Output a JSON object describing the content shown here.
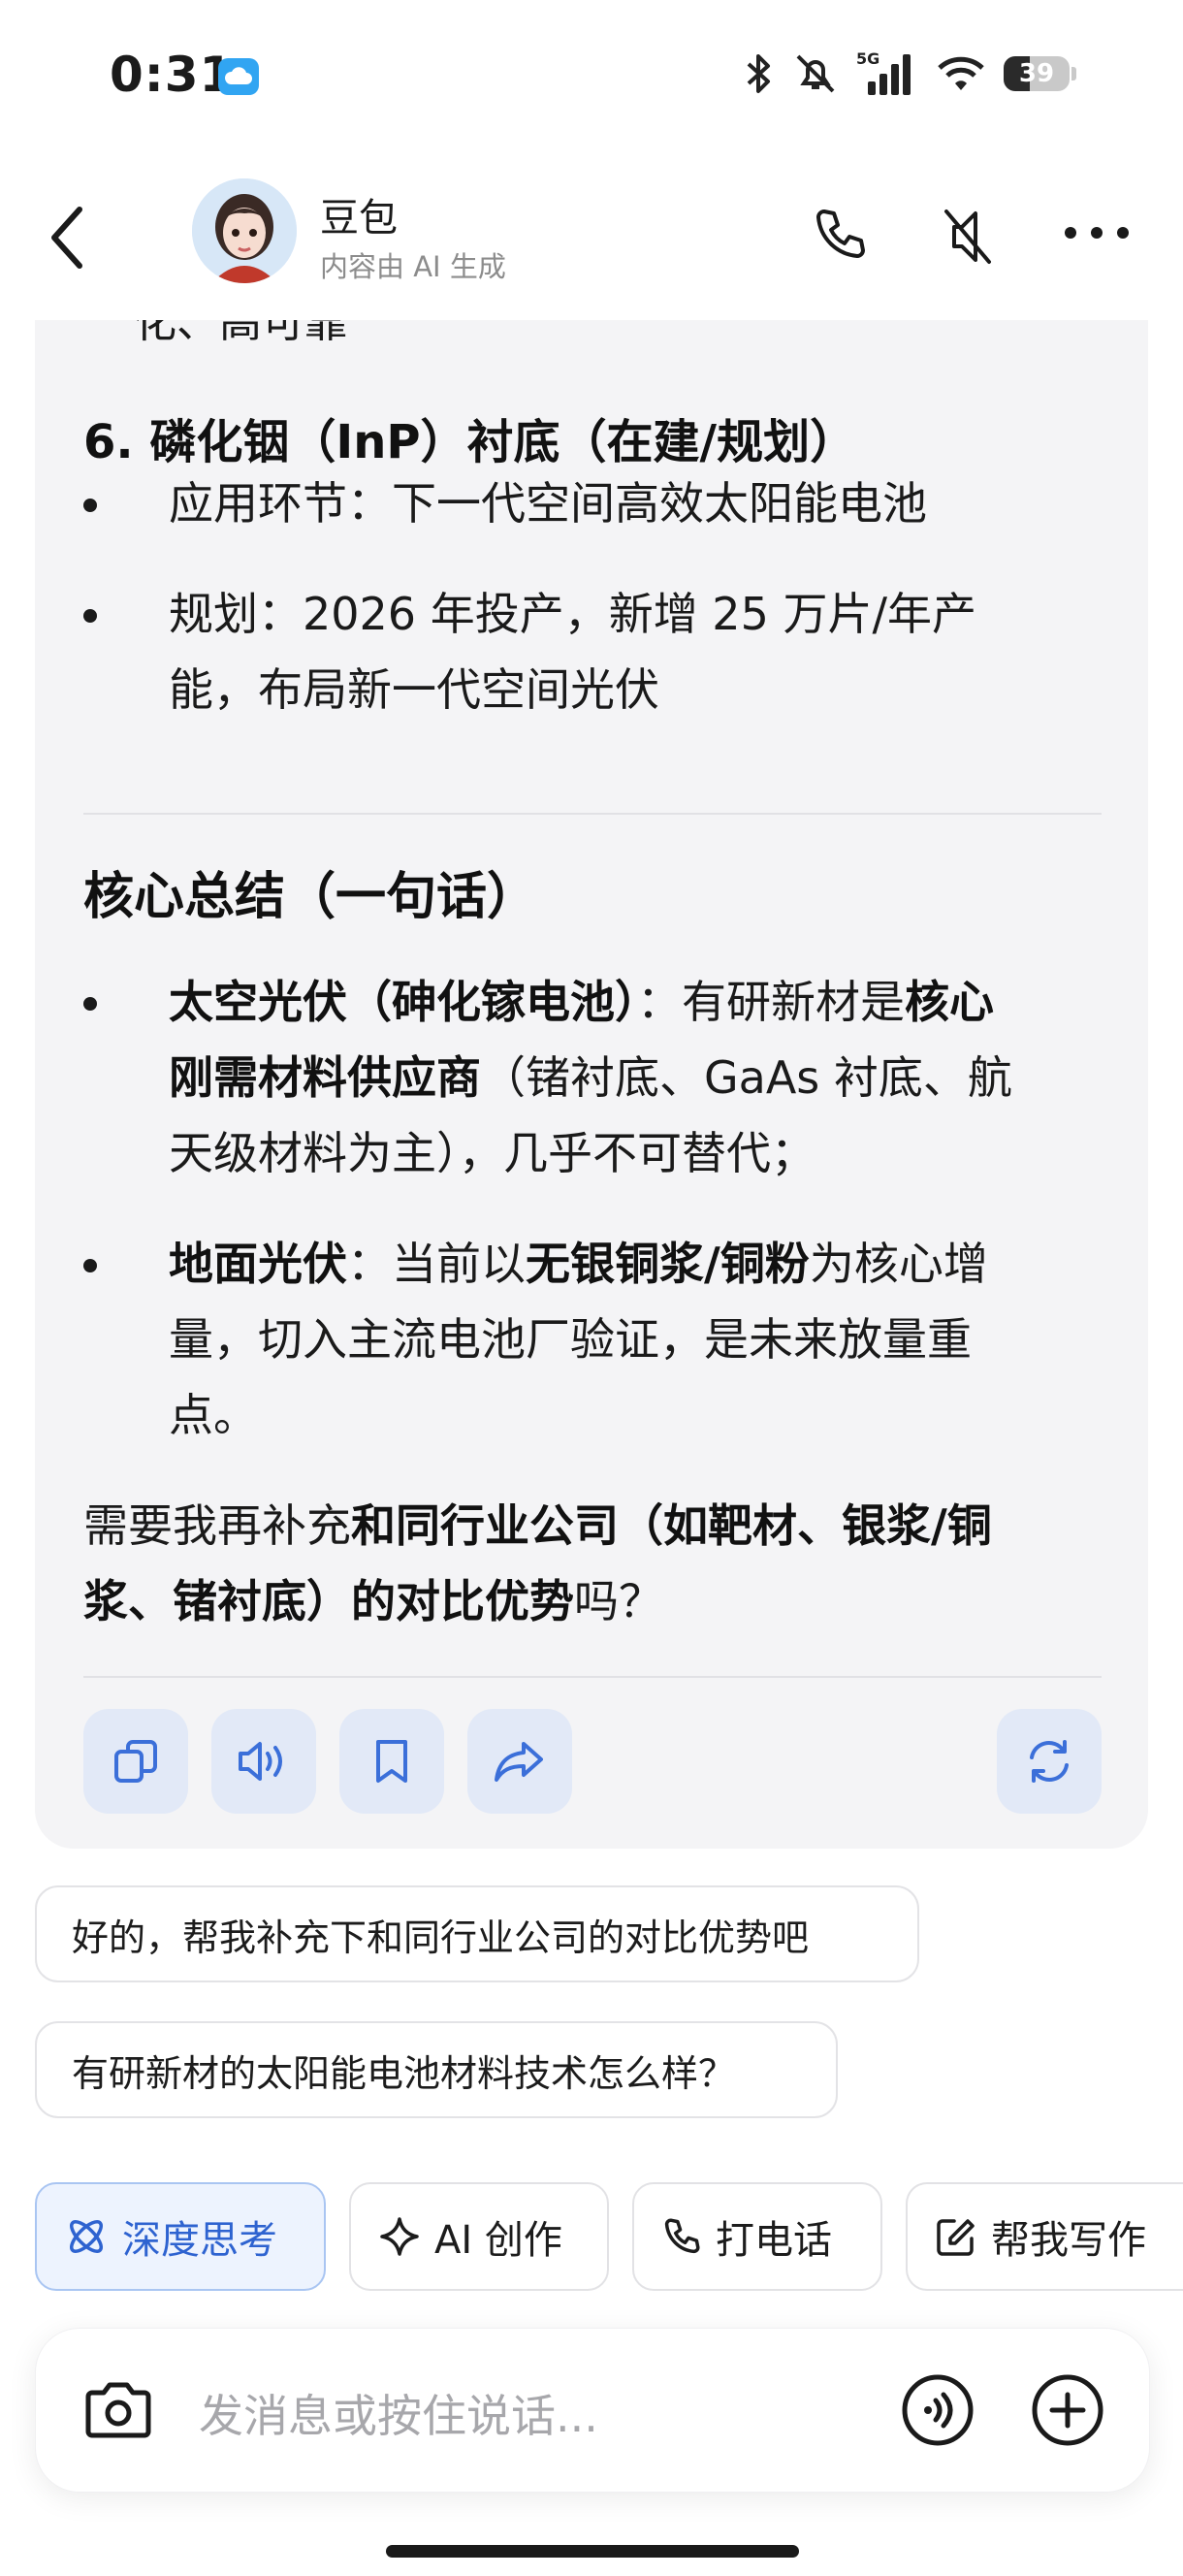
{
  "status_bar": {
    "time": "0:31",
    "battery": "39",
    "network": "5G"
  },
  "header": {
    "name": "豆包",
    "subtitle": "内容由 AI 生成"
  },
  "message": {
    "cut_line": "化、高可靠",
    "section6_title": "6. 磷化铟（InP）衬底（在建/规划）",
    "s6_b1": "应用环节：下一代空间高效太阳能电池",
    "s6_b2_l1": "规划：2026 年投产，新增 25 万片/年产",
    "s6_b2_l2": "能，布局新一代空间光伏",
    "summary_title": "核心总结（一句话）",
    "sum1_l1_bold": "太空光伏（砷化镓电池）",
    "sum1_l1_mid": "：有研新材是",
    "sum1_l1_bold2": "核心",
    "sum1_l2_bold": "刚需材料供应商",
    "sum1_l2_rest": "（锗衬底、GaAs 衬底、航",
    "sum1_l3": "天级材料为主），几乎不可替代；",
    "sum2_l1_bold": "地面光伏",
    "sum2_l1_mid": "：当前以",
    "sum2_l1_bold2": "无银铜浆/铜粉",
    "sum2_l1_rest": "为核心增",
    "sum2_l2": "量，切入主流电池厂验证，是未来放量重",
    "sum2_l3": "点。",
    "closing_l1_pre": "需要我再补充",
    "closing_l1_bold": "和同行业公司（如靶材、银浆/铜",
    "closing_l2_bold": "浆、锗衬底）的对比优势",
    "closing_l2_post": "吗？"
  },
  "suggestions": [
    "好的，帮我补充下和同行业公司的对比优势吧",
    "有研新材的太阳能电池材料技术怎么样？"
  ],
  "tools": [
    "深度思考",
    "AI 创作",
    "打电话",
    "帮我写作"
  ],
  "input": {
    "placeholder": "发消息或按住说话..."
  }
}
